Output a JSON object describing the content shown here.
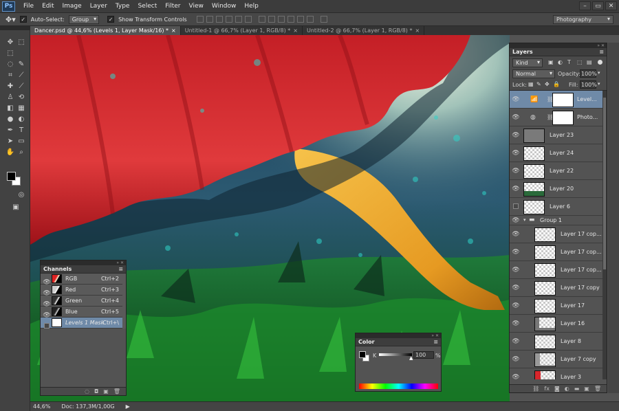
{
  "app": {
    "logo": "Ps",
    "menu": [
      "File",
      "Edit",
      "Image",
      "Layer",
      "Type",
      "Select",
      "Filter",
      "View",
      "Window",
      "Help"
    ],
    "window_controls": [
      "–",
      "▭",
      "✕"
    ]
  },
  "options": {
    "tool_icon": "move-tool-icon",
    "auto_select_label": "Auto-Select:",
    "auto_select_value": "Group",
    "show_transform_label": "Show Transform Controls",
    "workspace": "Photography"
  },
  "tabs": [
    {
      "label": "Dancer.psd @ 44,6% (Levels 1, Layer Mask/16) *",
      "close": "×"
    },
    {
      "label": "Untitled-1 @ 66,7% (Layer 1, RGB/8) *",
      "close": "×"
    },
    {
      "label": "Untitled-2 @ 66,7% (Layer 1, RGB/8) *",
      "close": "×"
    }
  ],
  "status": {
    "zoom": "44,6%",
    "doc": "Doc: 137,3M/1,00G",
    "arrow": "▶"
  },
  "channels": {
    "title": "Channels",
    "rows": [
      {
        "name": "RGB",
        "key": "Ctrl+2"
      },
      {
        "name": "Red",
        "key": "Ctrl+3"
      },
      {
        "name": "Green",
        "key": "Ctrl+4"
      },
      {
        "name": "Blue",
        "key": "Ctrl+5"
      },
      {
        "name": "Levels 1 Mask",
        "key": "Ctrl+\\"
      }
    ]
  },
  "color": {
    "title": "Color",
    "channel": "K",
    "value": "100",
    "unit": "%"
  },
  "layers": {
    "title": "Layers",
    "kind": "Kind",
    "blend": "Normal",
    "opacity_label": "Opacity:",
    "opacity": "100%",
    "lock_label": "Lock:",
    "fill_label": "Fill:",
    "fill": "100%",
    "group_name": "Group 1",
    "rows": [
      {
        "name": "Level..."
      },
      {
        "name": "Photo..."
      },
      {
        "name": "Layer 23"
      },
      {
        "name": "Layer 24"
      },
      {
        "name": "Layer 22"
      },
      {
        "name": "Layer 20"
      },
      {
        "name": "Layer 6"
      },
      {
        "name": "Layer 17 cop..."
      },
      {
        "name": "Layer 17 cop..."
      },
      {
        "name": "Layer 17 cop..."
      },
      {
        "name": "Layer 17 copy"
      },
      {
        "name": "Layer 17"
      },
      {
        "name": "Layer 16"
      },
      {
        "name": "Layer 8"
      },
      {
        "name": "Layer 7 copy"
      },
      {
        "name": "Layer 3"
      }
    ]
  },
  "accent": {
    "selected_row": "#6f8aa8",
    "dress_red": "#d8262c"
  }
}
